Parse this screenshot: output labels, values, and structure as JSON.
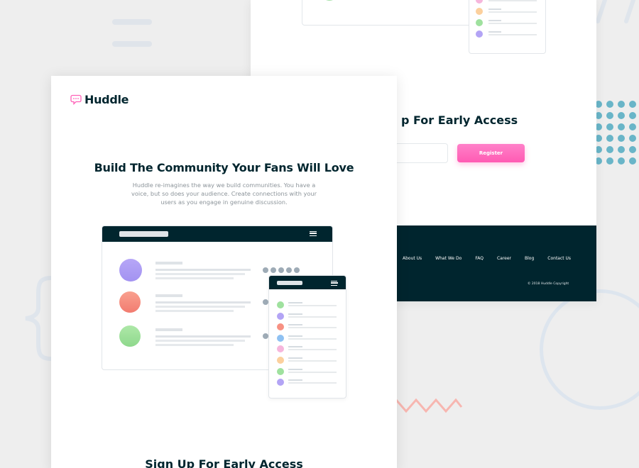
{
  "colors": {
    "dark_navy": "#00252e",
    "pink": "#ff61b8",
    "teal_dots": "#69b5c8",
    "salmon_zigzag": "#f7b6b0",
    "avatar_purple": "#b3a4f5",
    "avatar_red": "#f79183",
    "avatar_green": "#9fe19e"
  },
  "front_page": {
    "logo_icon": "chat-bubble-icon",
    "logo_text": "Huddle",
    "hero_title": "Build The Community Your Fans Will Love",
    "hero_text": "Huddle re-imagines the way we build communities. You have a voice, but so does your audience. Create connections with your users as you engage in genuine discussion.",
    "signup_heading": "Sign Up For Early Access"
  },
  "back_page": {
    "cta_heading": "p For Early Access",
    "register_button": "Register",
    "footer_nav": [
      "About Us",
      "What We Do",
      "FAQ",
      "Career",
      "Blog",
      "Contact Us"
    ],
    "copyright": "© 2018 Huddle Copyright"
  }
}
